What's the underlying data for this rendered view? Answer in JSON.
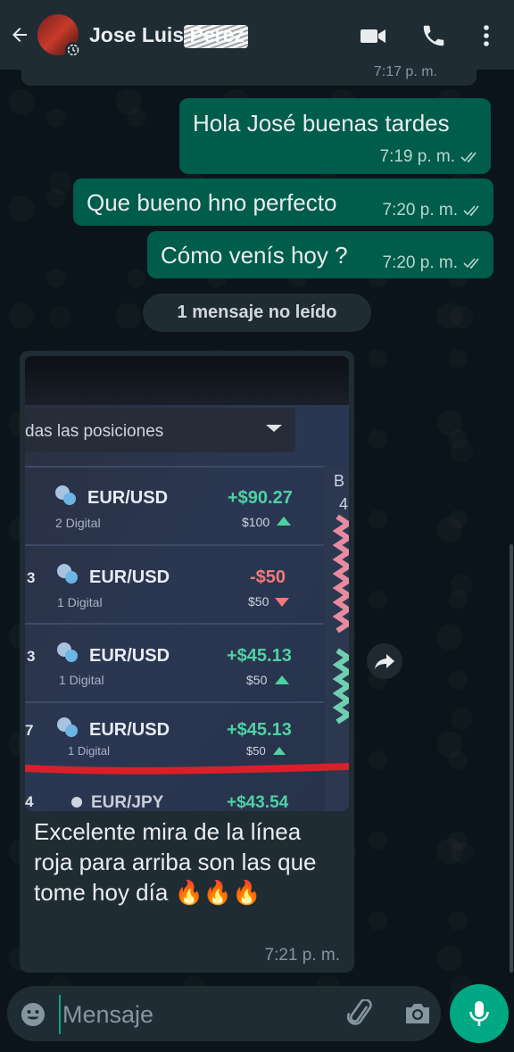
{
  "header": {
    "contact_name": "Jose Luis Perez",
    "icons": [
      "arrow-left-icon",
      "video-call-icon",
      "phone-icon",
      "more-vert-icon"
    ]
  },
  "previous_message": {
    "time": "7:17 p. m."
  },
  "messages": [
    {
      "text": "Hola José buenas tardes",
      "time": "7:19 p. m."
    },
    {
      "text": "Que bueno hno perfecto",
      "time": "7:20 p. m."
    },
    {
      "text": "Cómo venís hoy ?",
      "time": "7:20 p. m."
    }
  ],
  "unread_divider": "1 mensaje no leído",
  "incoming": {
    "caption": "Excelente mira de la línea roja para arriba son las que tome hoy día 🔥🔥🔥",
    "time": "7:21 p. m.",
    "photo": {
      "dropdown_label": "das las posiciones",
      "side_label": "B",
      "side_number": "4",
      "positions": [
        {
          "row_num": "",
          "pair": "EUR/USD",
          "sub": "2 Digital",
          "profit": "+$90.27",
          "amount": "$100",
          "direction": "up",
          "color": "#4fd1a5"
        },
        {
          "row_num": "3",
          "pair": "EUR/USD",
          "sub": "1 Digital",
          "profit": "-$50",
          "amount": "$50",
          "direction": "down",
          "color": "#f07a7a"
        },
        {
          "row_num": "3",
          "pair": "EUR/USD",
          "sub": "1 Digital",
          "profit": "+$45.13",
          "amount": "$50",
          "direction": "up",
          "color": "#4fd1a5"
        },
        {
          "row_num": "7",
          "pair": "EUR/USD",
          "sub": "1 Digital",
          "profit": "+$45.13",
          "amount": "$50",
          "direction": "up",
          "color": "#4fd1a5"
        },
        {
          "row_num": "4",
          "pair": "EUR/JPY",
          "sub": "",
          "profit": "+$43.54",
          "amount": "",
          "direction": "up",
          "color": "#4fd1a5"
        }
      ]
    }
  },
  "composer": {
    "placeholder": "Mensaje",
    "icons": [
      "emoji-icon",
      "attach-icon",
      "camera-icon",
      "mic-icon"
    ]
  },
  "colors": {
    "header_bg": "#1f2c34",
    "chat_bg": "#0b141a",
    "outgoing_bubble": "#005c4b",
    "incoming_bubble": "#1f2c34",
    "accent": "#00a884"
  }
}
